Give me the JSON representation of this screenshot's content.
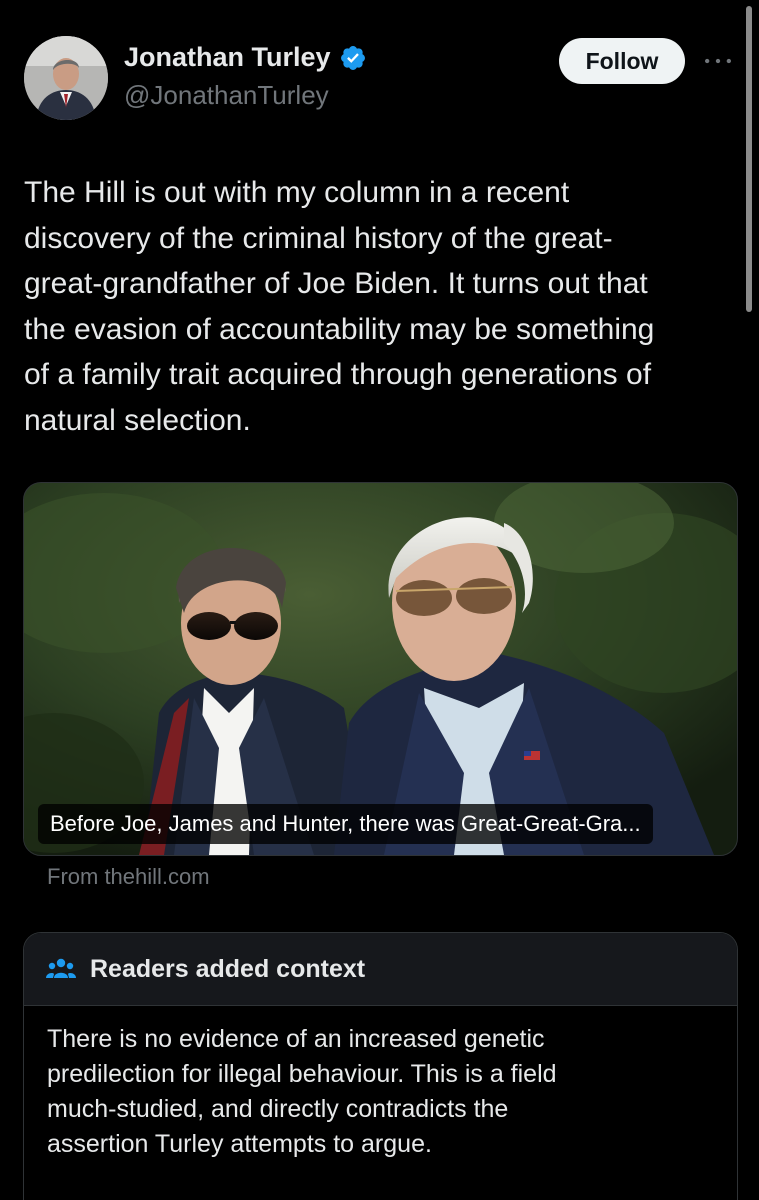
{
  "author": {
    "display_name": "Jonathan Turley",
    "handle": "@JonathanTurley",
    "verified": true
  },
  "actions": {
    "follow_label": "Follow"
  },
  "tweet": {
    "text_lines": [
      "The Hill is out with my column in a recent",
      "discovery of the criminal history of the great-",
      "great-grandfather of Joe Biden. It turns out that",
      "the evasion of accountability may be something",
      "of a family trait acquired through generations of",
      "natural selection."
    ]
  },
  "link_card": {
    "caption": "Before Joe, James and Hunter, there was Great-Great-Gra...",
    "source": "From thehill.com"
  },
  "community_note": {
    "title": "Readers added context",
    "body_lines": [
      "There is no evidence of an increased genetic",
      "predilection for illegal behaviour. This is a field",
      "much-studied, and directly contradicts the",
      "assertion Turley attempts to argue."
    ]
  },
  "icons": {
    "verified": "verified-badge-icon",
    "more": "more-horizontal-icon",
    "note": "people-group-icon"
  },
  "colors": {
    "background": "#000000",
    "text_primary": "#e7e9ea",
    "text_secondary": "#71767b",
    "verified_blue": "#1d9bf0",
    "follow_bg": "#eff3f4",
    "border": "#2f3336"
  }
}
